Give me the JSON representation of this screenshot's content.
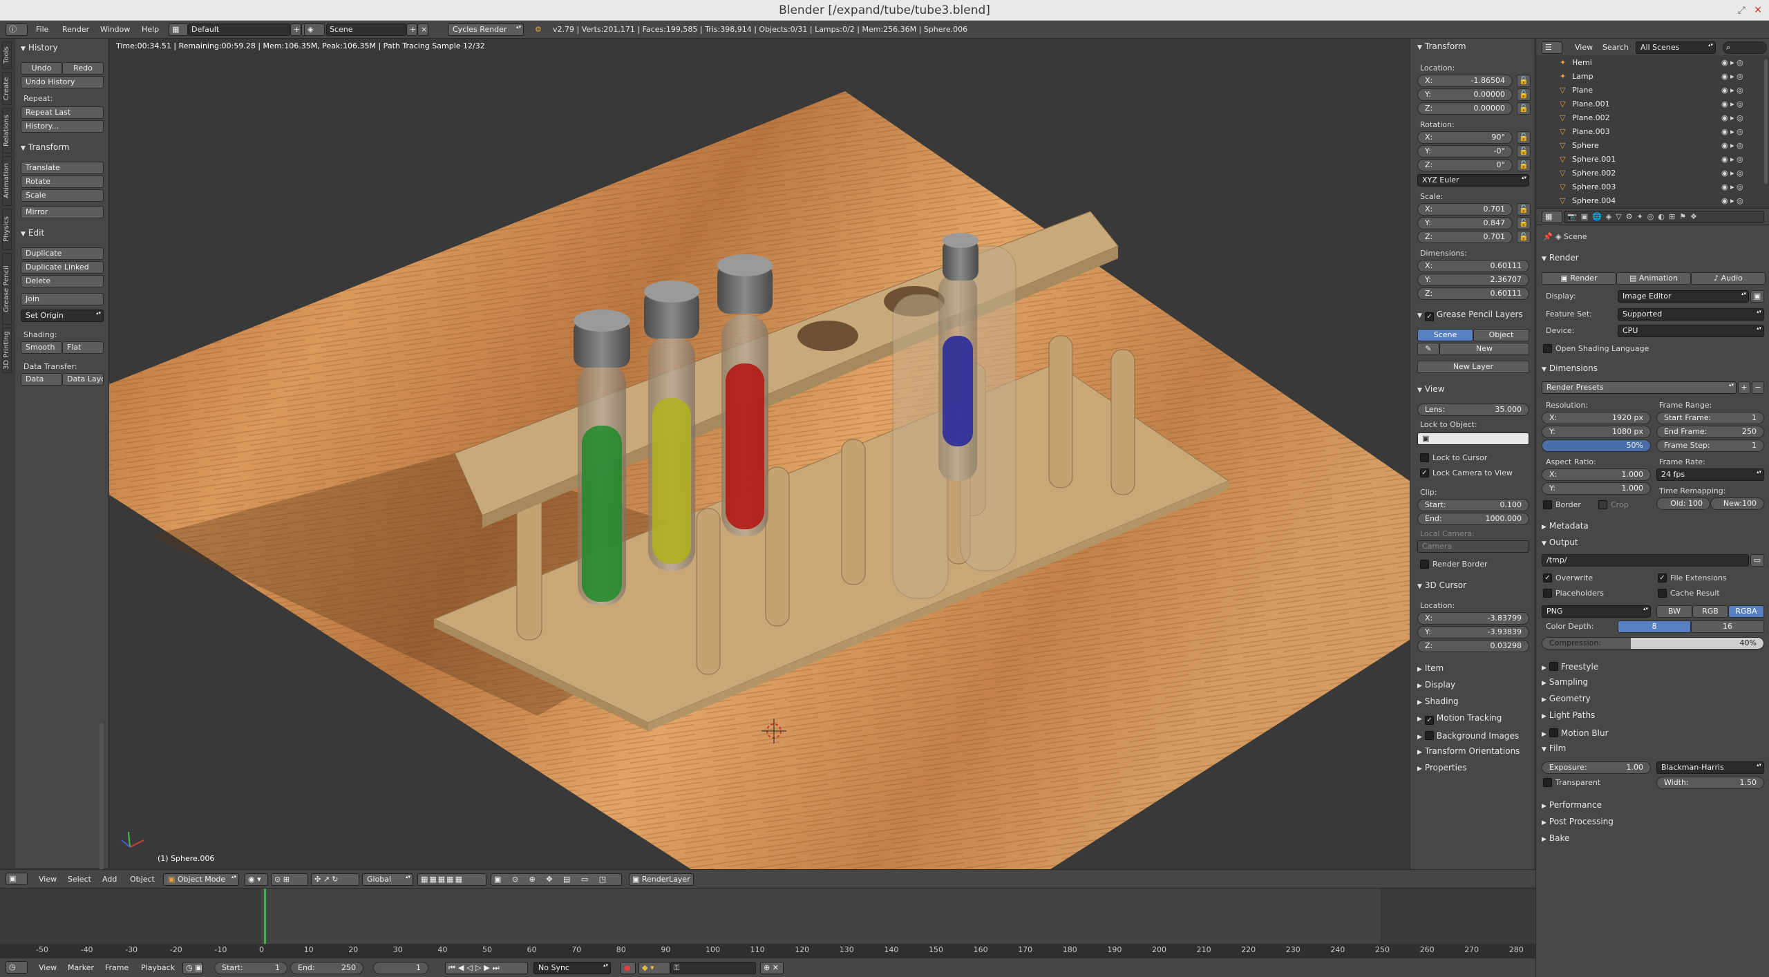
{
  "window": {
    "title": "Blender [/expand/tube/tube3.blend]",
    "close": "✕",
    "restore": "⤢"
  },
  "infobar": {
    "menu": [
      "File",
      "Render",
      "Window",
      "Help"
    ],
    "layout": "Default",
    "scene": "Scene",
    "engine": "Cycles Render",
    "stats": "v2.79 | Verts:201,171 | Faces:199,585 | Tris:398,914 | Objects:0/31 | Lamps:0/2 | Mem:256.36M | Sphere.006"
  },
  "toolshelf": {
    "tabs": [
      "Tools",
      "Create",
      "Relations",
      "Animation",
      "Physics",
      "Grease Pencil",
      "3D Printing"
    ],
    "history": {
      "title": "History",
      "undo": "Undo",
      "redo": "Redo",
      "undo_history": "Undo History",
      "repeat_label": "Repeat:",
      "repeat_last": "Repeat Last",
      "history": "History..."
    },
    "transform": {
      "title": "Transform",
      "translate": "Translate",
      "rotate": "Rotate",
      "scale": "Scale",
      "mirror": "Mirror"
    },
    "edit": {
      "title": "Edit",
      "duplicate": "Duplicate",
      "duplicate_linked": "Duplicate Linked",
      "delete": "Delete",
      "join": "Join",
      "set_origin": "Set Origin",
      "shading_label": "Shading:",
      "smooth": "Smooth",
      "flat": "Flat",
      "data_transfer_label": "Data Transfer:",
      "data": "Data",
      "data_layo": "Data Layo"
    }
  },
  "viewport": {
    "status": "Time:00:34.51 | Remaining:00:59.28 | Mem:106.35M, Peak:106.35M | Path Tracing Sample 12/32",
    "object_label": "(1) Sphere.006"
  },
  "npanel": {
    "transform": {
      "title": "Transform",
      "location_label": "Location:",
      "location": [
        {
          "k": "X:",
          "v": "-1.86504"
        },
        {
          "k": "Y:",
          "v": "0.00000"
        },
        {
          "k": "Z:",
          "v": "0.00000"
        }
      ],
      "rotation_label": "Rotation:",
      "rotation": [
        {
          "k": "X:",
          "v": "90°"
        },
        {
          "k": "Y:",
          "v": "-0°"
        },
        {
          "k": "Z:",
          "v": "0°"
        }
      ],
      "rotation_mode": "XYZ Euler",
      "scale_label": "Scale:",
      "scale": [
        {
          "k": "X:",
          "v": "0.701"
        },
        {
          "k": "Y:",
          "v": "0.847"
        },
        {
          "k": "Z:",
          "v": "0.701"
        }
      ],
      "dimensions_label": "Dimensions:",
      "dimensions": [
        {
          "k": "X:",
          "v": "0.60111"
        },
        {
          "k": "Y:",
          "v": "2.36707"
        },
        {
          "k": "Z:",
          "v": "0.60111"
        }
      ]
    },
    "grease": {
      "title": "Grease Pencil Layers",
      "scene": "Scene",
      "object": "Object",
      "new": "New",
      "new_layer": "New Layer"
    },
    "view": {
      "title": "View",
      "lens_k": "Lens:",
      "lens_v": "35.000",
      "lock_to_object": "Lock to Object:",
      "lock_to_cursor": "Lock to Cursor",
      "lock_camera": "Lock Camera to View",
      "clip": "Clip:",
      "start_k": "Start:",
      "start_v": "0.100",
      "end_k": "End:",
      "end_v": "1000.000",
      "local_camera": "Local Camera:",
      "camera": "Camera",
      "render_border": "Render Border"
    },
    "cursor": {
      "title": "3D Cursor",
      "location_label": "Location:",
      "loc": [
        {
          "k": "X:",
          "v": "-3.83799"
        },
        {
          "k": "Y:",
          "v": "-3.93839"
        },
        {
          "k": "Z:",
          "v": "0.03298"
        }
      ]
    },
    "collapsed": [
      "Item",
      "Display",
      "Shading",
      "Motion Tracking",
      "Background Images",
      "Transform Orientations",
      "Properties"
    ]
  },
  "outliner": {
    "view": "View",
    "search": "Search",
    "scenes": "All Scenes",
    "items": [
      "Hemi",
      "Lamp",
      "Plane",
      "Plane.001",
      "Plane.002",
      "Plane.003",
      "Sphere",
      "Sphere.001",
      "Sphere.002",
      "Sphere.003",
      "Sphere.004"
    ]
  },
  "properties": {
    "breadcrumb": "Scene",
    "render": {
      "title": "Render",
      "render_btn": "Render",
      "animation_btn": "Animation",
      "audio_btn": "Audio",
      "display_k": "Display:",
      "display_v": "Image Editor",
      "feature_k": "Feature Set:",
      "feature_v": "Supported",
      "device_k": "Device:",
      "device_v": "CPU",
      "osl": "Open Shading Language"
    },
    "dimensions": {
      "title": "Dimensions",
      "presets": "Render Presets",
      "resolution": "Resolution:",
      "res_x_k": "X:",
      "res_x_v": "1920 px",
      "res_y_k": "Y:",
      "res_y_v": "1080 px",
      "pct": "50%",
      "aspect": "Aspect Ratio:",
      "asp_x_k": "X:",
      "asp_x_v": "1.000",
      "asp_y_k": "Y:",
      "asp_y_v": "1.000",
      "border": "Border",
      "crop": "Crop",
      "frame_range": "Frame Range:",
      "start_k": "Start Frame:",
      "start_v": "1",
      "end_k": "End Frame:",
      "end_v": "250",
      "step_k": "Frame Step:",
      "step_v": "1",
      "frame_rate": "Frame Rate:",
      "fps": "24 fps",
      "time_remap": "Time Remapping:",
      "old": "Old: 100",
      "new": "New:100"
    },
    "metadata": "Metadata",
    "output": {
      "title": "Output",
      "path": "/tmp/",
      "overwrite": "Overwrite",
      "file_ext": "File Extensions",
      "placeholders": "Placeholders",
      "cache": "Cache Result",
      "format": "PNG",
      "bw": "BW",
      "rgb": "RGB",
      "rgba": "RGBA",
      "depth_k": "Color Depth:",
      "d8": "8",
      "d16": "16",
      "compression": "Compression:",
      "comp_v": "40%"
    },
    "collapsed": [
      "Freestyle",
      "Sampling",
      "Geometry",
      "Light Paths",
      "Motion Blur"
    ],
    "film": {
      "title": "Film",
      "exposure_k": "Exposure:",
      "exposure_v": "1.00",
      "filter": "Blackman-Harris",
      "transparent": "Transparent",
      "width_k": "Width:",
      "width_v": "1.50"
    },
    "collapsed2": [
      "Performance",
      "Post Processing",
      "Bake"
    ]
  },
  "view3d_header": {
    "menus": [
      "View",
      "Select",
      "Add",
      "Object"
    ],
    "mode": "Object Mode",
    "orientation": "Global",
    "render_layer": "RenderLayer"
  },
  "timeline": {
    "ticks": [
      "-50",
      "-40",
      "-30",
      "-20",
      "-10",
      "0",
      "10",
      "20",
      "30",
      "40",
      "50",
      "60",
      "70",
      "80",
      "90",
      "100",
      "110",
      "120",
      "130",
      "140",
      "150",
      "160",
      "170",
      "180",
      "190",
      "200",
      "210",
      "220",
      "230",
      "240",
      "250",
      "260",
      "270",
      "280"
    ],
    "menus": [
      "View",
      "Marker",
      "Frame",
      "Playback"
    ],
    "start_k": "Start:",
    "start_v": "1",
    "end_k": "End:",
    "end_v": "250",
    "current": "1",
    "sync": "No Sync"
  }
}
